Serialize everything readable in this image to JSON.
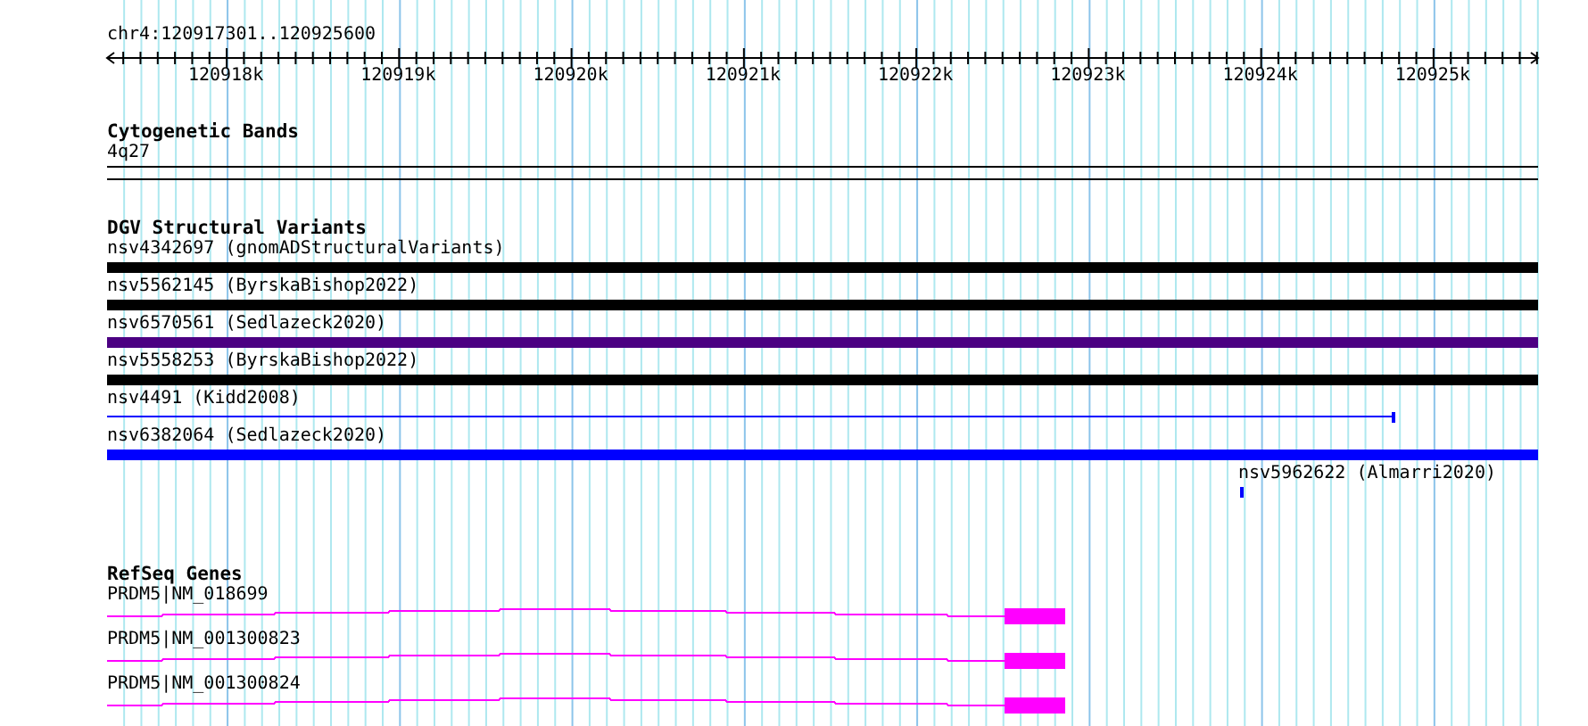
{
  "ruler": {
    "region": "chr4:120917301..120925600",
    "ticks": [
      "120918k",
      "120919k",
      "120920k",
      "120921k",
      "120922k",
      "120923k",
      "120924k",
      "120925k"
    ]
  },
  "tracks": [
    {
      "kind": "cytoband",
      "title": "Cytogenetic Bands",
      "features": [
        {
          "label": "4q27",
          "kind": "band"
        }
      ]
    },
    {
      "kind": "variants",
      "title": "DGV Structural Variants",
      "features": [
        {
          "label": "nsv4342697 (gnomADStructuralVariants)",
          "kind": "bar",
          "color": "#000000"
        },
        {
          "label": "nsv5562145 (ByrskaBishop2022)",
          "kind": "bar",
          "color": "#000000"
        },
        {
          "label": "nsv6570561 (Sedlazeck2020)",
          "kind": "bar",
          "color": "#4b0082"
        },
        {
          "label": "nsv5558253 (ByrskaBishop2022)",
          "kind": "bar",
          "color": "#000000"
        },
        {
          "label": "nsv4491 (Kidd2008)",
          "kind": "line",
          "color": "#0000ff"
        },
        {
          "label": "nsv6382064 (Sedlazeck2020)",
          "kind": "bar",
          "color": "#0000ff"
        },
        {
          "label": "nsv5962622 (Almarri2020)",
          "kind": "point",
          "color": "#0000ff"
        }
      ]
    },
    {
      "kind": "genes",
      "title": "RefSeq Genes",
      "features": [
        {
          "label": "PRDM5|NM_018699",
          "kind": "gene"
        },
        {
          "label": "PRDM5|NM_001300823",
          "kind": "gene"
        },
        {
          "label": "PRDM5|NM_001300824",
          "kind": "gene"
        }
      ]
    }
  ]
}
